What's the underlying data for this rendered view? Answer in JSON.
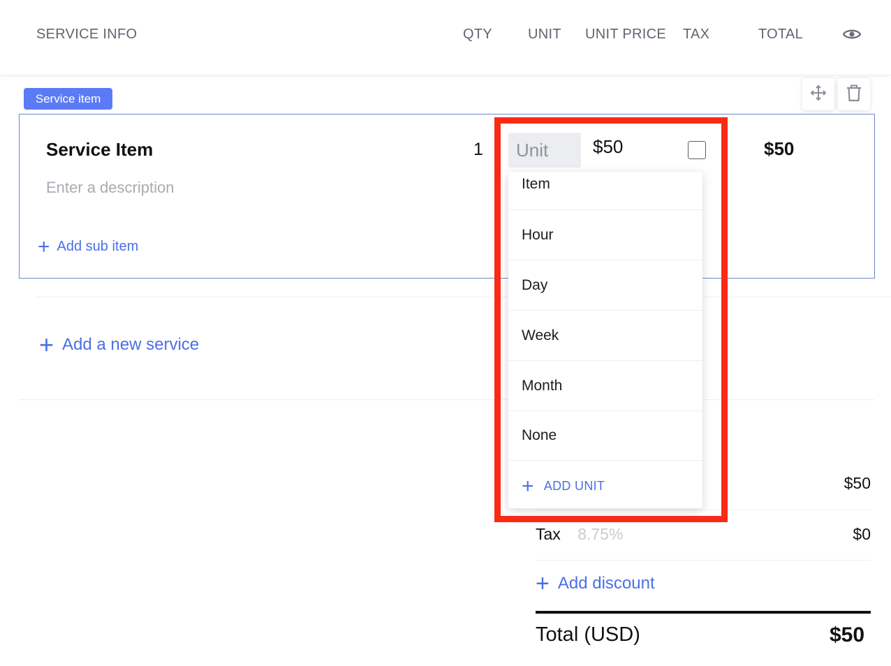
{
  "header": {
    "service_info": "SERVICE INFO",
    "qty": "QTY",
    "unit": "UNIT",
    "unit_price": "UNIT PRICE",
    "tax": "TAX",
    "total": "TOTAL",
    "visibility_icon": "eye-icon"
  },
  "item": {
    "badge": "Service item",
    "title": "Service Item",
    "description_placeholder": "Enter a description",
    "add_sub_item": "Add sub item",
    "qty": "1",
    "unit_placeholder": "Unit",
    "unit_price": "$50",
    "taxable": false,
    "total": "$50",
    "move_icon": "move-icon",
    "delete_icon": "trash-icon"
  },
  "add_service": "Add a new service",
  "unit_dropdown": {
    "options": [
      "Item",
      "Hour",
      "Day",
      "Week",
      "Month",
      "None"
    ],
    "add_unit": "ADD UNIT"
  },
  "summary": {
    "subtotal_value": "$50",
    "tax_label": "Tax",
    "tax_rate": "8.75%",
    "tax_value": "$0",
    "add_discount": "Add discount",
    "total_label": "Total (USD)",
    "total_value": "$50"
  },
  "colors": {
    "accent": "#4a70e6",
    "badge": "#5b7bf6",
    "highlight": "#fa2a14",
    "card_border": "#6f86c9"
  }
}
